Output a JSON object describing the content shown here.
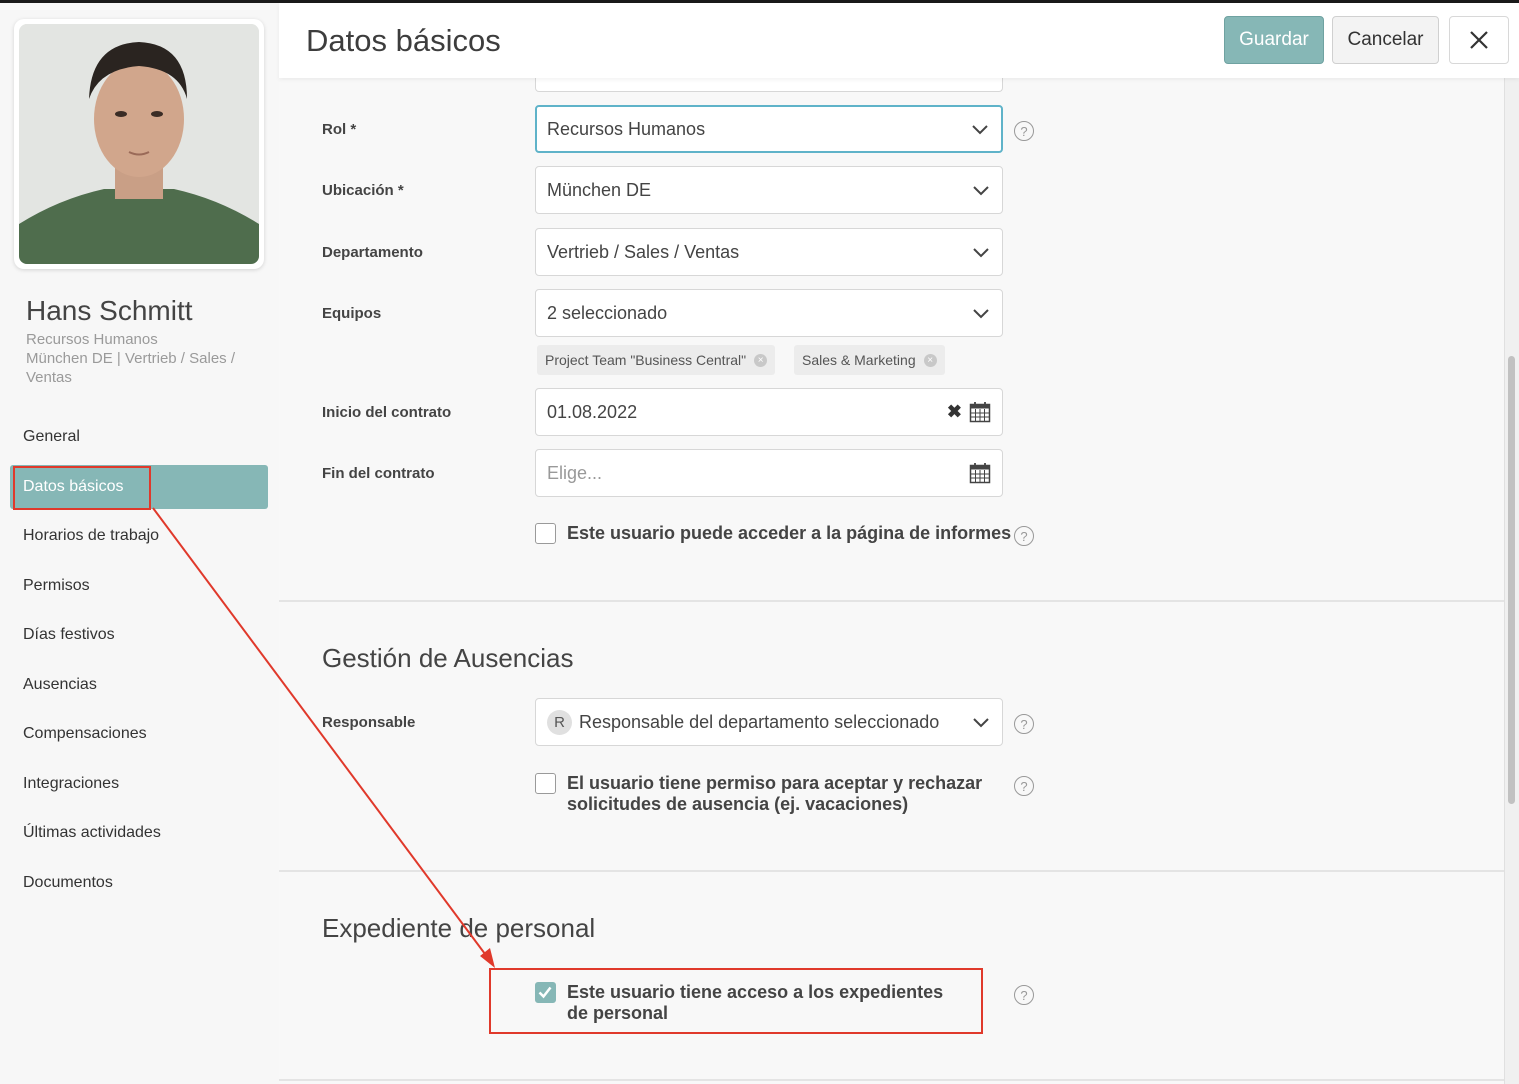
{
  "user": {
    "name": "Hans Schmitt",
    "role": "Recursos Humanos",
    "location_department": "München DE | Vertrieb / Sales / Ventas"
  },
  "nav": {
    "items": [
      {
        "label": "General"
      },
      {
        "label": "Datos básicos",
        "active": true
      },
      {
        "label": "Horarios de trabajo"
      },
      {
        "label": "Permisos"
      },
      {
        "label": "Días festivos"
      },
      {
        "label": "Ausencias"
      },
      {
        "label": "Compensaciones"
      },
      {
        "label": "Integraciones"
      },
      {
        "label": "Últimas actividades"
      },
      {
        "label": "Documentos"
      }
    ]
  },
  "header": {
    "title": "Datos básicos",
    "save_label": "Guardar",
    "cancel_label": "Cancelar",
    "close_icon": "×"
  },
  "form": {
    "role": {
      "label": "Rol *",
      "value": "Recursos Humanos"
    },
    "location": {
      "label": "Ubicación *",
      "value": "München DE"
    },
    "department": {
      "label": "Departamento",
      "value": "Vertrieb / Sales / Ventas"
    },
    "teams": {
      "label": "Equipos",
      "value": "2 seleccionado",
      "tags": [
        "Project Team \"Business Central\"",
        "Sales & Marketing"
      ]
    },
    "contract_start": {
      "label": "Inicio del contrato",
      "value": "01.08.2022"
    },
    "contract_end": {
      "label": "Fin del contrato",
      "placeholder": "Elige..."
    },
    "reports_access": {
      "label": "Este usuario puede acceder a la página de informes",
      "checked": false
    }
  },
  "absence": {
    "title": "Gestión de Ausencias",
    "responsible_label": "Responsable",
    "responsible_avatar": "R",
    "responsible_value": "Responsable del departamento seleccionado",
    "approve_label": "El usuario tiene permiso para aceptar y rechazar solicitudes de ausencia (ej. vacaciones)",
    "approve_checked": false
  },
  "personnel": {
    "title": "Expediente de personal",
    "access_label": "Este usuario tiene acceso a los expedientes de personal",
    "access_checked": true
  },
  "colors": {
    "accent": "#86b7b6",
    "focus": "#5fb3c9",
    "annotation": "#e0392b"
  }
}
